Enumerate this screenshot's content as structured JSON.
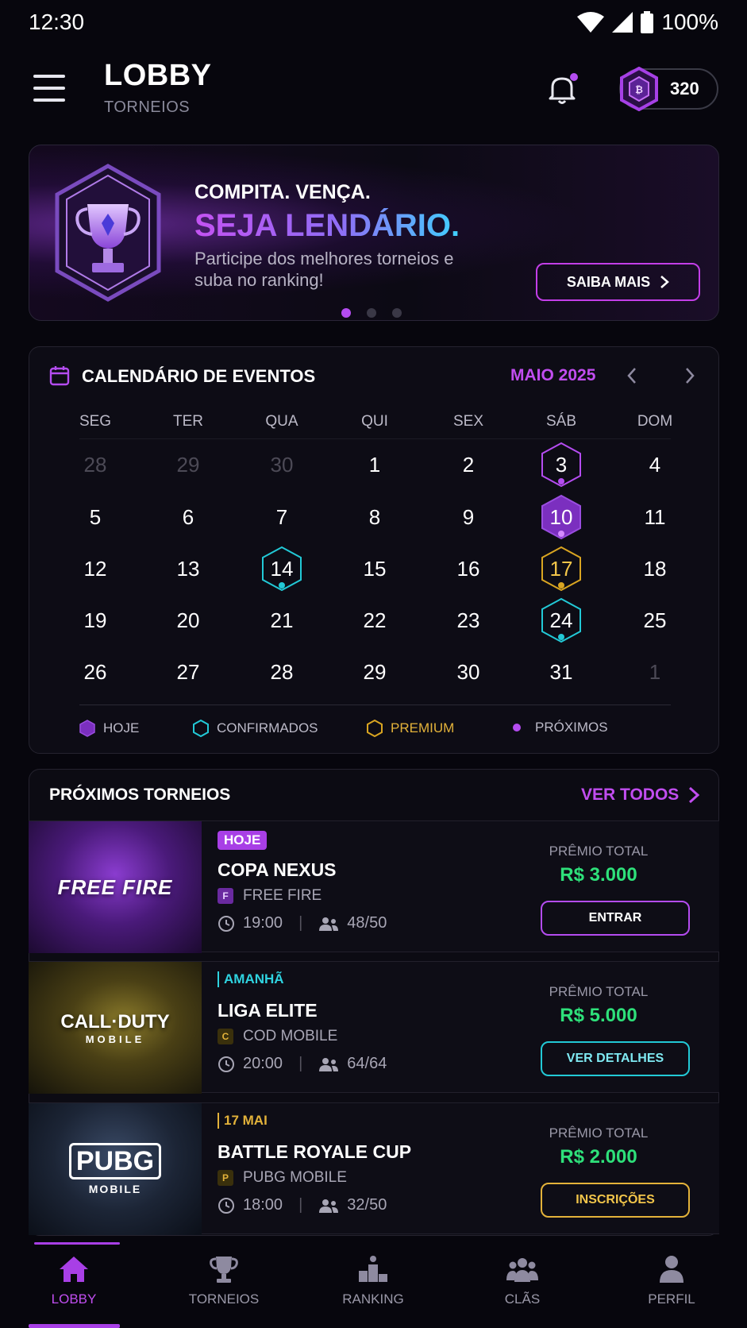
{
  "status_bar": {
    "time": "12:30",
    "battery": "100%"
  },
  "header": {
    "title": "LOBBY",
    "subtitle": "TORNEIOS",
    "coins": "320"
  },
  "banner": {
    "kicker": "COMPITA. VENÇA.",
    "headline": "SEJA LENDÁRIO.",
    "description": "Participe dos melhores torneios e suba no ranking!",
    "cta": "SAIBA MAIS",
    "slides": 3,
    "active_slide": 1
  },
  "calendar": {
    "title": "CALENDÁRIO DE EVENTOS",
    "month": "MAIO 2025",
    "weekdays": [
      "SEG",
      "TER",
      "QUA",
      "QUI",
      "SEX",
      "SÁB",
      "DOM"
    ],
    "weeks": [
      [
        {
          "d": "28",
          "muted": true
        },
        {
          "d": "29",
          "muted": true
        },
        {
          "d": "30",
          "muted": true
        },
        {
          "d": "1"
        },
        {
          "d": "2"
        },
        {
          "d": "3",
          "mark": "upcoming-outline"
        },
        {
          "d": "4"
        }
      ],
      [
        {
          "d": "5"
        },
        {
          "d": "6"
        },
        {
          "d": "7"
        },
        {
          "d": "8"
        },
        {
          "d": "9"
        },
        {
          "d": "10",
          "mark": "today"
        },
        {
          "d": "11"
        }
      ],
      [
        {
          "d": "12"
        },
        {
          "d": "13"
        },
        {
          "d": "14",
          "mark": "confirmed"
        },
        {
          "d": "15"
        },
        {
          "d": "16"
        },
        {
          "d": "17",
          "mark": "premium"
        },
        {
          "d": "18"
        }
      ],
      [
        {
          "d": "19"
        },
        {
          "d": "20"
        },
        {
          "d": "21"
        },
        {
          "d": "22"
        },
        {
          "d": "23"
        },
        {
          "d": "24",
          "mark": "confirmed"
        },
        {
          "d": "25"
        }
      ],
      [
        {
          "d": "26"
        },
        {
          "d": "27"
        },
        {
          "d": "28"
        },
        {
          "d": "29"
        },
        {
          "d": "30"
        },
        {
          "d": "31"
        },
        {
          "d": "1",
          "muted": true
        }
      ]
    ],
    "legend": {
      "today": "HOJE",
      "confirmed": "CONFIRMADOS",
      "premium": "PREMIUM",
      "upcoming": "PRÓXIMOS"
    },
    "colors": {
      "today": "#7b2fbf",
      "confirmed": "#22c9d6",
      "premium": "#d9a521",
      "upcoming": "#b44cf0"
    }
  },
  "tournaments": {
    "heading": "PRÓXIMOS TORNEIOS",
    "see_all": "VER TODOS",
    "prize_label": "PRÊMIO TOTAL",
    "items": [
      {
        "badge": "HOJE",
        "name": "COPA NEXUS",
        "game": "FREE FIRE",
        "logo": "FREE FIRE",
        "time": "19:00",
        "players": "48/50",
        "prize": "R$ 3.000",
        "action": "ENTRAR"
      },
      {
        "badge": "AMANHÃ",
        "name": "LIGA ELITE",
        "game": "COD MOBILE",
        "logo": "CALL·DUTY",
        "logo_sub": "MOBILE",
        "time": "20:00",
        "players": "64/64",
        "prize": "R$ 5.000",
        "action": "VER DETALHES"
      },
      {
        "badge": "17 MAI",
        "name": "BATTLE ROYALE CUP",
        "game": "PUBG MOBILE",
        "logo": "PUBG",
        "logo_sub": "MOBILE",
        "time": "18:00",
        "players": "32/50",
        "prize": "R$ 2.000",
        "action": "INSCRIÇÕES"
      }
    ]
  },
  "nav": {
    "items": [
      {
        "label": "LOBBY",
        "icon": "home-icon",
        "active": true
      },
      {
        "label": "TORNEIOS",
        "icon": "trophy-icon"
      },
      {
        "label": "RANKING",
        "icon": "podium-icon"
      },
      {
        "label": "CLÃS",
        "icon": "group-icon"
      },
      {
        "label": "PERFIL",
        "icon": "user-icon"
      }
    ]
  }
}
